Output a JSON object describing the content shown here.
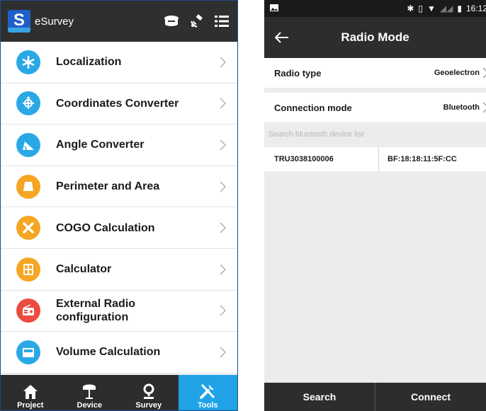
{
  "left": {
    "app_title": "eSurvey",
    "logo_letter": "S",
    "header_icons": [
      "receiver-icon",
      "satellite-icon",
      "list-menu-icon"
    ],
    "menu": [
      {
        "label": "Localization",
        "icon": "localization-icon",
        "color": "#2aa8e6"
      },
      {
        "label": "Coordinates Converter",
        "icon": "coordinates-icon",
        "color": "#2aa8e6"
      },
      {
        "label": "Angle Converter",
        "icon": "angle-icon",
        "color": "#2aa8e6"
      },
      {
        "label": "Perimeter and Area",
        "icon": "area-icon",
        "color": "#f5a623"
      },
      {
        "label": "COGO Calculation",
        "icon": "cogo-icon",
        "color": "#f5a623"
      },
      {
        "label": "Calculator",
        "icon": "calculator-icon",
        "color": "#f5a623"
      },
      {
        "label": "External Radio configuration",
        "icon": "radio-icon",
        "color": "#ec4b3f"
      },
      {
        "label": "Volume Calculation",
        "icon": "volume-icon",
        "color": "#2aa8e6"
      }
    ],
    "tabs": [
      {
        "label": "Project",
        "active": false
      },
      {
        "label": "Device",
        "active": false
      },
      {
        "label": "Survey",
        "active": false
      },
      {
        "label": "Tools",
        "active": true
      }
    ],
    "active_color": "#1fa3e6"
  },
  "right": {
    "status_time": "16:12",
    "title": "Radio Mode",
    "radio_type_label": "Radio type",
    "radio_type_value": "Geoelectron",
    "connection_mode_label": "Connection mode",
    "connection_mode_value": "Bluetooth",
    "search_list_label": "Search bluetooth device list",
    "device": {
      "name": "TRU3038100006",
      "mac": "BF:18:18:11:5F:CC"
    },
    "search_button": "Search",
    "connect_button": "Connect"
  }
}
